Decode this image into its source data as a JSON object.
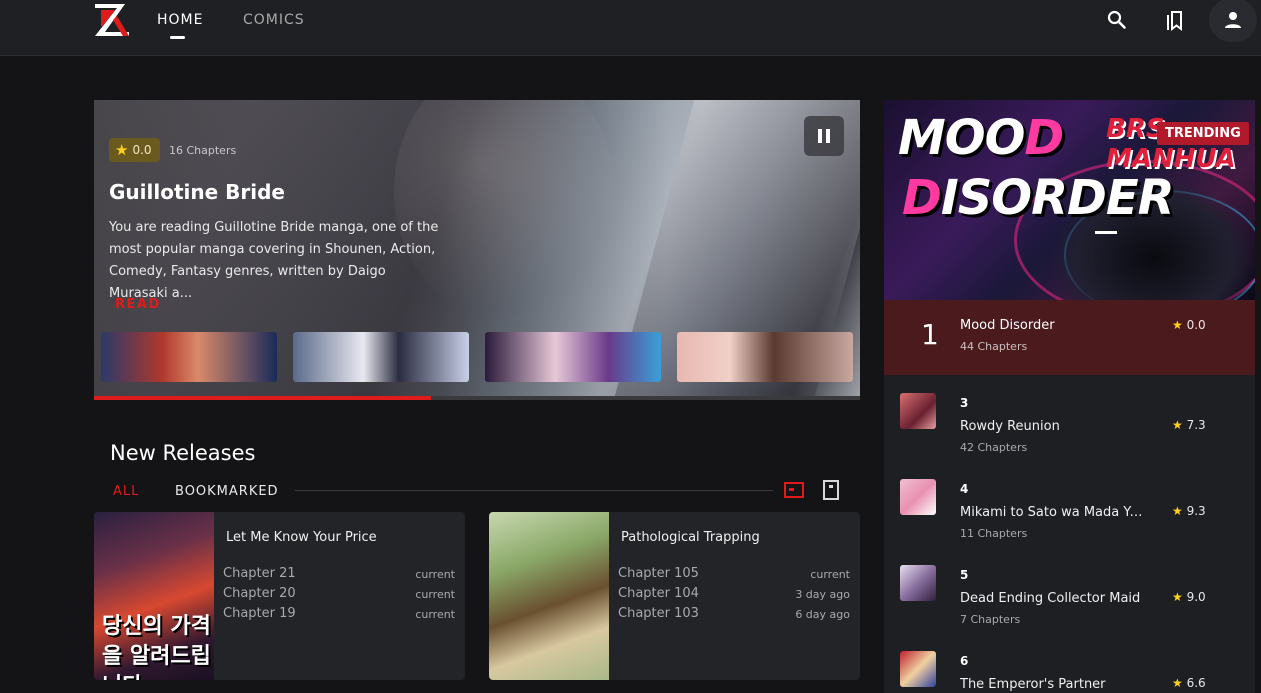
{
  "nav": {
    "links": [
      {
        "label": "HOME",
        "active": true
      },
      {
        "label": "COMICS",
        "active": false
      }
    ],
    "icons": [
      "search-icon",
      "bookmarks-icon",
      "user-icon"
    ],
    "accent_color": "#e01b1b"
  },
  "hero": {
    "rating": "0.0",
    "chapters": "16 Chapters",
    "title": "Guillotine Bride",
    "description": "You are reading Guillotine Bride manga, one of the most popular manga covering in Shounen, Action, Comedy, Fantasy genres, written by Daigo Murasaki a...",
    "read_label": "READ",
    "progress": 0.44
  },
  "new_releases": {
    "title": "New Releases",
    "filters": [
      {
        "label": "ALL",
        "active": true
      },
      {
        "label": "BOOKMARKED",
        "active": false
      }
    ],
    "items": [
      {
        "title": "Let Me Know Your Price",
        "cover_text": "당신의 가격을 알려드립니다",
        "chapters": [
          {
            "name": "Chapter 21",
            "time": "current"
          },
          {
            "name": "Chapter 20",
            "time": "current"
          },
          {
            "name": "Chapter 19",
            "time": "current"
          }
        ]
      },
      {
        "title": "Pathological Trapping",
        "chapters": [
          {
            "name": "Chapter 105",
            "time": "current"
          },
          {
            "name": "Chapter 104",
            "time": "3 day ago"
          },
          {
            "name": "Chapter 103",
            "time": "6 day ago"
          }
        ]
      }
    ]
  },
  "trending": {
    "badge": "TRENDING",
    "banner_title_1a": "MOO",
    "banner_title_1b": "D",
    "banner_title_2a": "D",
    "banner_title_2b": "ISORDER",
    "banner_logo": "BRS MANHUA",
    "top": {
      "rank": "1",
      "title": "Mood Disorder",
      "chapters": "44 Chapters",
      "rating": "0.0"
    },
    "list": [
      {
        "rank": "3",
        "title": "Rowdy Reunion",
        "chapters": "42 Chapters",
        "rating": "7.3"
      },
      {
        "rank": "4",
        "title": "Mikami to Sato wa Mada Yama...",
        "chapters": "11 Chapters",
        "rating": "9.3"
      },
      {
        "rank": "5",
        "title": "Dead Ending Collector Maid",
        "chapters": "7 Chapters",
        "rating": "9.0"
      },
      {
        "rank": "6",
        "title": "The Emperor's Partner",
        "chapters": "",
        "rating": "6.6"
      }
    ]
  }
}
